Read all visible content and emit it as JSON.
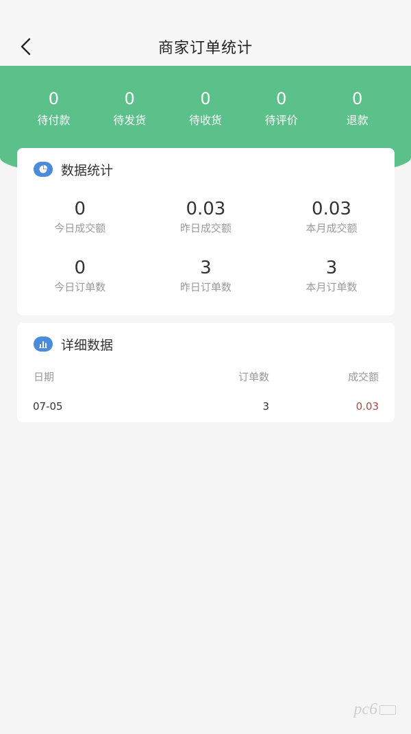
{
  "header": {
    "title": "商家订单统计"
  },
  "status_tabs": [
    {
      "count": "0",
      "label": "待付款"
    },
    {
      "count": "0",
      "label": "待发货"
    },
    {
      "count": "0",
      "label": "待收货"
    },
    {
      "count": "0",
      "label": "待评价"
    },
    {
      "count": "0",
      "label": "退款"
    }
  ],
  "stats": {
    "title": "数据统计",
    "icon": "pie-chart-icon",
    "rows": [
      [
        {
          "value": "0",
          "label": "今日成交额"
        },
        {
          "value": "0.03",
          "label": "昨日成交额"
        },
        {
          "value": "0.03",
          "label": "本月成交额"
        }
      ],
      [
        {
          "value": "0",
          "label": "今日订单数"
        },
        {
          "value": "3",
          "label": "昨日订单数"
        },
        {
          "value": "3",
          "label": "本月订单数"
        }
      ]
    ]
  },
  "detail": {
    "title": "详细数据",
    "icon": "bar-chart-icon",
    "columns": {
      "date": "日期",
      "orders": "订单数",
      "amount": "成交额"
    },
    "rows": [
      {
        "date": "07-05",
        "orders": "3",
        "amount": "0.03"
      }
    ]
  },
  "colors": {
    "banner": "#5cc08a",
    "icon_blue": "#4a8bdc",
    "amount_red": "#b04a4a"
  }
}
